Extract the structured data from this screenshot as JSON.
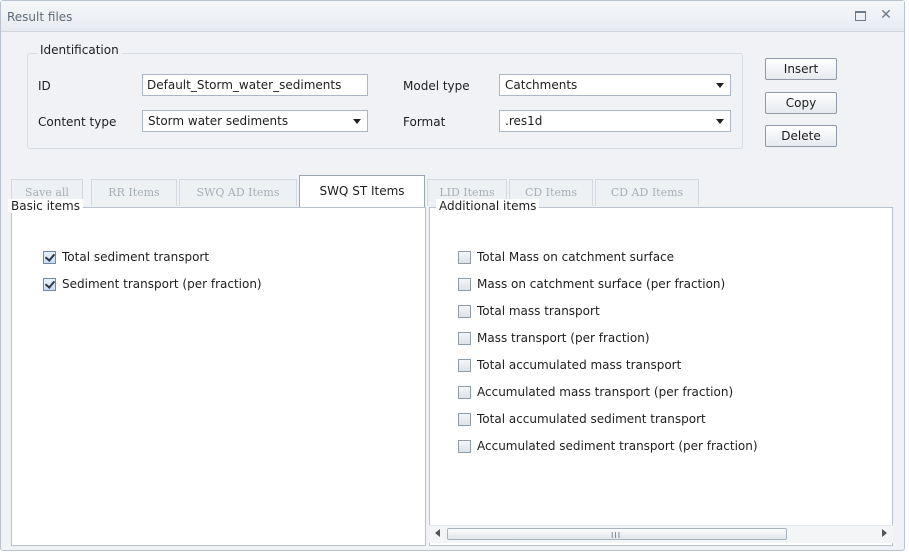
{
  "window": {
    "title": "Result files"
  },
  "identification": {
    "legend": "Identification",
    "id_label": "ID",
    "id_value": "Default_Storm_water_sediments",
    "content_type_label": "Content type",
    "content_type_value": "Storm water sediments",
    "model_type_label": "Model type",
    "model_type_value": "Catchments",
    "format_label": "Format",
    "format_value": ".res1d"
  },
  "buttons": {
    "insert": "Insert",
    "copy": "Copy",
    "delete": "Delete"
  },
  "tabs": [
    {
      "label": "Save all",
      "active": false
    },
    {
      "label": "RR Items",
      "active": false
    },
    {
      "label": "SWQ AD Items",
      "active": false
    },
    {
      "label": "SWQ ST Items",
      "active": true
    },
    {
      "label": "LID Items",
      "active": false
    },
    {
      "label": "CD Items",
      "active": false
    },
    {
      "label": "CD AD Items",
      "active": false
    }
  ],
  "basic_items": {
    "legend": "Basic items",
    "items": [
      {
        "label": "Total sediment transport",
        "checked": true
      },
      {
        "label": "Sediment transport (per fraction)",
        "checked": true
      }
    ]
  },
  "additional_items": {
    "legend": "Additional items",
    "items": [
      {
        "label": "Total Mass on catchment surface",
        "checked": false
      },
      {
        "label": "Mass on catchment surface (per fraction)",
        "checked": false
      },
      {
        "label": "Total mass transport",
        "checked": false
      },
      {
        "label": "Mass transport (per fraction)",
        "checked": false
      },
      {
        "label": "Total accumulated mass transport",
        "checked": false
      },
      {
        "label": "Accumulated mass transport (per fraction)",
        "checked": false
      },
      {
        "label": "Total accumulated sediment transport",
        "checked": false
      },
      {
        "label": "Accumulated sediment transport (per fraction)",
        "checked": false
      }
    ]
  },
  "scrollbar": {
    "grip": "III"
  },
  "colors": {
    "window_bg": "#f0f2f5",
    "panel_bg": "#ffffff",
    "border": "#b9c3cf",
    "disabled_tab_text": "#a6aeb8"
  }
}
